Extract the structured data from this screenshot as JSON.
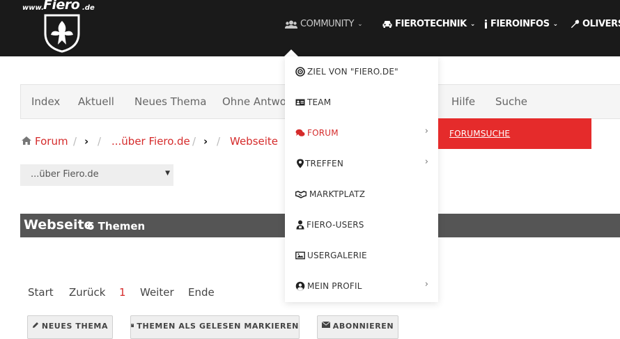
{
  "brand": {
    "www": "www.",
    "name": "Fiero",
    "tld": ".de"
  },
  "topnav": [
    {
      "label": "COMMUNITY",
      "icon": "users-icon",
      "active": true
    },
    {
      "label": "FIEROTECHNIK",
      "icon": "car-icon"
    },
    {
      "label": "FIEROINFOS",
      "icon": "info-icon"
    },
    {
      "label": "OLIVERS",
      "icon": "wrench-icon"
    }
  ],
  "subnav": [
    "Index",
    "Aktuell",
    "Neues Thema",
    "Ohne Antwort",
    "Hilfe",
    "Suche"
  ],
  "breadcrumb": {
    "home": "Forum",
    "sep": "/",
    "item2": "...über Fiero.de",
    "item3": "Webseite"
  },
  "forum_select": {
    "value": "...über Fiero.de"
  },
  "section": {
    "title": "Webseite",
    "count": "6 Themen"
  },
  "pager": {
    "start": "Start",
    "prev": "Zurück",
    "current": "1",
    "next": "Weiter",
    "end": "Ende"
  },
  "actions": {
    "new_topic": "NEUES THEMA",
    "mark_read": "THEMEN ALS GELESEN MARKIEREN",
    "subscribe": "ABONNIEREN"
  },
  "community_menu": [
    {
      "label": "ZIEL VON \"FIERO.DE\"",
      "icon": "target-icon"
    },
    {
      "label": "TEAM",
      "icon": "id-card-icon"
    },
    {
      "label": "FORUM",
      "icon": "comments-icon",
      "submenu": true,
      "active": true
    },
    {
      "label": "TREFFEN",
      "icon": "map-marker-icon",
      "submenu": true
    },
    {
      "label": "MARKTPLATZ",
      "icon": "handshake-icon"
    },
    {
      "label": "FIERO-USERS",
      "icon": "user-icon"
    },
    {
      "label": "USERGALERIE",
      "icon": "image-icon"
    },
    {
      "label": "MEIN PROFIL",
      "icon": "user-circle-icon",
      "submenu": true
    }
  ],
  "forum_submenu": {
    "item": "FORUMSUCHE"
  },
  "colors": {
    "accent": "#d52b2b",
    "flyout": "#e52b2b",
    "topbar": "#1a1a1a",
    "section": "#555555"
  }
}
